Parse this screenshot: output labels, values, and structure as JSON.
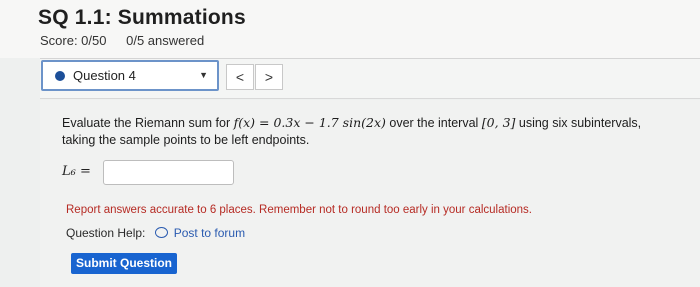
{
  "header": {
    "title": "SQ 1.1: Summations",
    "score": "Score: 0/50",
    "answered": "0/5 answered"
  },
  "question_nav": {
    "selected": "Question 4",
    "prev_glyph": "<",
    "next_glyph": ">"
  },
  "question": {
    "text_before": "Evaluate the Riemann sum for ",
    "function": "f(x) = 0.3x − 1.7 sin(2x)",
    "text_middle": " over the interval ",
    "interval": "[0, 3]",
    "text_after": " using six subintervals, taking the sample points to be left endpoints.",
    "answer_label": "L₆ =",
    "answer_value": ""
  },
  "note": "Report answers accurate to 6 places. Remember not to round too early in your calculations.",
  "help": {
    "label": "Question Help:",
    "link": "Post to forum"
  },
  "submit_label": "Submit Question"
}
